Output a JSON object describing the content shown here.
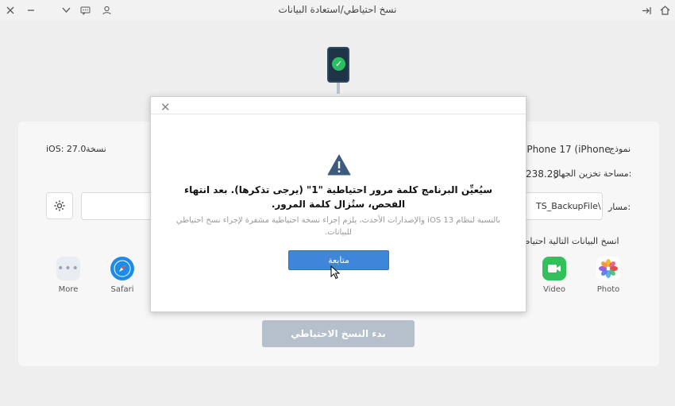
{
  "window": {
    "title": "نسخ احتياطي/استعادة البيانات"
  },
  "toolbar_icons": [
    "close-icon",
    "minimize-icon",
    "chevron-down-icon",
    "feedback-icon",
    "user-icon",
    "login-icon",
    "home-icon"
  ],
  "device": {
    "model_label": "نموذج",
    "model_value": "iPhone 17 (iPhone",
    "storage_label": "مساحة تخزين الجهاز:",
    "storage_value": "238.28",
    "version_label": "نسخة",
    "version_value": "iOS: 27.0"
  },
  "path": {
    "label": "مسار:",
    "value": "TS_BackupFile\\"
  },
  "backup_section_label": "انسخ البيانات التالية احتياطيا",
  "apps": [
    {
      "name": "Photo",
      "icon": "photos-icon"
    },
    {
      "name": "Video",
      "icon": "facetime-video-icon"
    },
    {
      "name": "Safari",
      "icon": "safari-icon"
    },
    {
      "name": "More",
      "icon": "more-icon"
    }
  ],
  "start_button": "بدء النسخ الاحتياطي",
  "dialog": {
    "message": "سيُعيِّن البرنامج كلمة مرور احتياطية \"1\" (يرجى تذكرها). بعد انتهاء الفحص، ستُزال كلمة المرور.",
    "note": "بالنسبة لنظام iOS 13 والإصدارات الأحدث، يلزم إجراء نسخة احتياطية مشفرة لإجراء نسخ احتياطي للبيانات.",
    "continue_label": "متابعة"
  },
  "colors": {
    "accent": "#3e86d9",
    "disabled_button": "#b6bfcc",
    "success": "#2bbf61",
    "warning": "#3d5a80"
  }
}
